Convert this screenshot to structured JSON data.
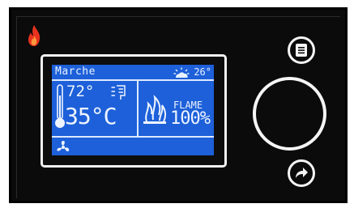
{
  "display": {
    "status": "Marche",
    "outdoor_temp": "26°",
    "setpoint_temp": "72°",
    "room_temp": "35°C",
    "flame_label": "FLAME",
    "flame_percent": "100%"
  },
  "colors": {
    "lcd_background": "#1d60d9",
    "lcd_text": "#eef4ff",
    "panel": "#0b0b0b",
    "logo_flame": "#e8321e"
  },
  "icons": {
    "logo": "flame-logo-icon",
    "outdoor": "sun-cloud-icon",
    "thermometer": "thermometer-icon",
    "schedule": "schedule-icon",
    "fire": "fire-icon",
    "fan": "fan-icon",
    "menu": "menu-list-icon",
    "next": "forward-arrow-icon"
  }
}
